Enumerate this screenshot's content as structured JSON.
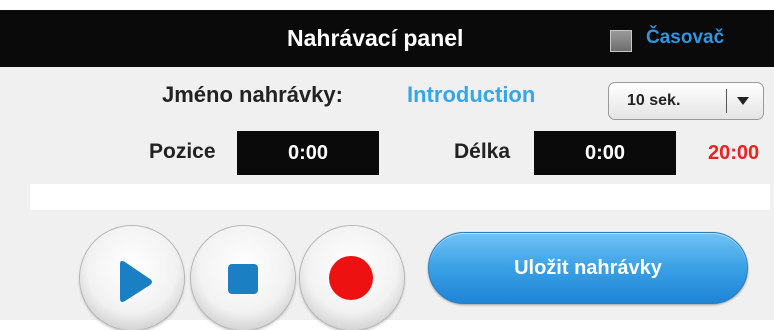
{
  "header": {
    "title": "Nahrávací panel",
    "timer_label": "Časovač",
    "timer_checked": false
  },
  "recording": {
    "name_label": "Jméno nahrávky:",
    "name_value": "Introduction",
    "interval_select": {
      "selected": "10 sek."
    }
  },
  "position": {
    "label": "Pozice",
    "value": "0:00"
  },
  "length": {
    "label": "Délka",
    "value": "0:00",
    "max": "20:00"
  },
  "progress": {
    "fraction": 0
  },
  "controls": {
    "play_icon": "play-icon",
    "stop_icon": "stop-icon",
    "record_icon": "record-icon",
    "save_label": "Uložit nahrávky"
  },
  "colors": {
    "accent": "#37a6e6",
    "record": "#ee1111",
    "max_length": "#ee2222"
  }
}
